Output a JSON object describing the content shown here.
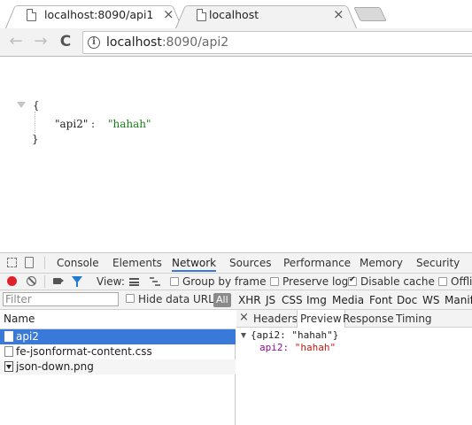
{
  "browser": {
    "tabs": [
      {
        "title": "localhost:8090/api1",
        "close": "×",
        "active": false
      },
      {
        "title": "localhost",
        "close": "×",
        "active": true
      }
    ],
    "nav": {
      "back": "←",
      "forward": "→",
      "reload": "C"
    },
    "omnibox": {
      "info": "i",
      "host": "localhost",
      "rest": ":8090/api2"
    }
  },
  "page": {
    "json": {
      "open_brace": "{",
      "key": "\"api2\"",
      "colon": ":",
      "value": "\"hahah\"",
      "close_brace": "}"
    }
  },
  "devtools": {
    "tabs": [
      "Console",
      "Elements",
      "Network",
      "Sources",
      "Performance",
      "Memory",
      "Security"
    ],
    "active_tab": "Network",
    "toolbar": {
      "view_label": "View:",
      "group_by_frame": "Group by frame",
      "preserve_log": "Preserve log",
      "disable_cache": "Disable cache",
      "offline": "Offli"
    },
    "filterbar": {
      "placeholder": "Filter",
      "hide_data_urls": "Hide data URLs",
      "all": "All",
      "types": [
        "XHR",
        "JS",
        "CSS",
        "Img",
        "Media",
        "Font",
        "Doc",
        "WS",
        "Manif"
      ]
    },
    "requests": {
      "header": "Name",
      "rows": [
        {
          "name": "api2",
          "selected": true
        },
        {
          "name": "fe-jsonformat-content.css",
          "selected": false
        },
        {
          "name": "json-down.png",
          "selected": false
        }
      ]
    },
    "detail": {
      "close": "×",
      "tabs": [
        "Headers",
        "Preview",
        "Response",
        "Timing"
      ],
      "active_tab": "Preview",
      "preview": {
        "summary": "{api2: \"hahah\"}",
        "prop_key": "api2:",
        "prop_value": "\"hahah\""
      }
    }
  }
}
